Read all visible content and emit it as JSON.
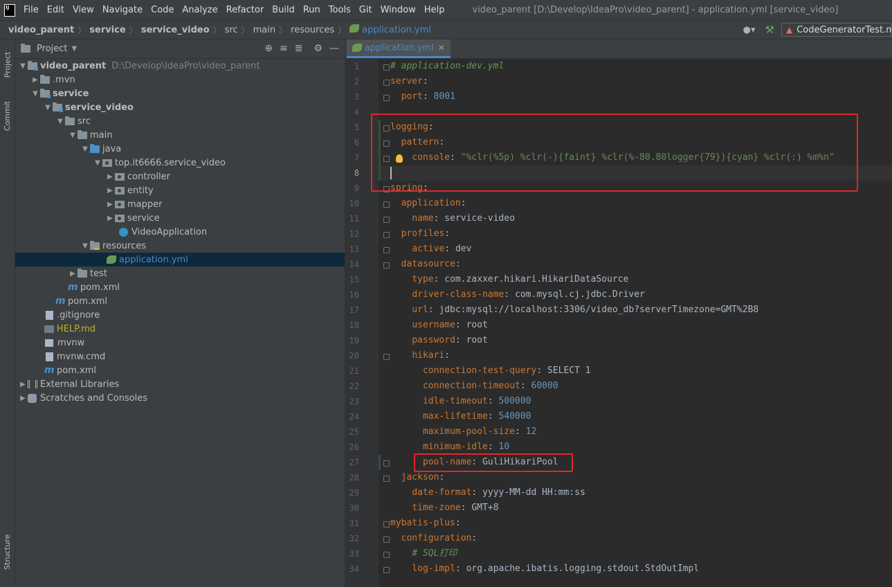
{
  "menubar": {
    "logo": "IJ",
    "items": [
      "File",
      "Edit",
      "View",
      "Navigate",
      "Code",
      "Analyze",
      "Refactor",
      "Build",
      "Run",
      "Tools",
      "Git",
      "Window",
      "Help"
    ],
    "window_title": "video_parent [D:\\Develop\\IdeaPro\\video_parent] - application.yml [service_video]"
  },
  "breadcrumbs": [
    "video_parent",
    "service",
    "service_video",
    "src",
    "main",
    "resources",
    "application.yml"
  ],
  "run_config": "CodeGeneratorTest.ma",
  "left_strip": {
    "project": "Project",
    "commit": "Commit",
    "structure": "Structure"
  },
  "project_panel": {
    "title": "Project",
    "root_name": "video_parent",
    "root_path": "D:\\Develop\\IdeaPro\\video_parent",
    "tree": [
      {
        "label": ".mvn"
      },
      {
        "label": "service"
      },
      {
        "label": "service_video"
      },
      {
        "label": "src"
      },
      {
        "label": "main"
      },
      {
        "label": "java"
      },
      {
        "label": "top.it6666.service_video"
      },
      {
        "label": "controller"
      },
      {
        "label": "entity"
      },
      {
        "label": "mapper"
      },
      {
        "label": "service"
      },
      {
        "label": "VideoApplication"
      },
      {
        "label": "resources"
      },
      {
        "label": "application.yml"
      },
      {
        "label": "test"
      },
      {
        "label": "pom.xml"
      },
      {
        "label": "pom.xml"
      },
      {
        "label": ".gitignore"
      },
      {
        "label": "HELP.md"
      },
      {
        "label": "mvnw"
      },
      {
        "label": "mvnw.cmd"
      },
      {
        "label": "pom.xml"
      },
      {
        "label": "External Libraries"
      },
      {
        "label": "Scratches and Consoles"
      }
    ]
  },
  "editor": {
    "tab_label": "application.yml",
    "line_numbers": [
      "1",
      "2",
      "3",
      "4",
      "5",
      "6",
      "7",
      "8",
      "9",
      "10",
      "11",
      "12",
      "13",
      "14",
      "15",
      "16",
      "17",
      "18",
      "19",
      "20",
      "21",
      "22",
      "23",
      "24",
      "25",
      "26",
      "27",
      "28",
      "29",
      "30",
      "31",
      "32",
      "33",
      "34"
    ],
    "lines": {
      "l1": "# application-dev.yml",
      "l2_key": "server",
      "l3_key": "port",
      "l3_val": "8001",
      "l5_key": "logging",
      "l6_key": "pattern",
      "l7_key": "console",
      "l7_val": "\"%clr(%5p) %clr(-){faint} %clr(%-80.80logger{79}){cyan} %clr(:) %m%n\"",
      "l9_key": "spring",
      "l10_key": "application",
      "l11_key": "name",
      "l11_val": "service-video",
      "l12_key": "profiles",
      "l13_key": "active",
      "l13_val": "dev",
      "l14_key": "datasource",
      "l15_key": "type",
      "l15_val": "com.zaxxer.hikari.HikariDataSource",
      "l16_key": "driver-class-name",
      "l16_val": "com.mysql.cj.jdbc.Driver",
      "l17_key": "url",
      "l17_val": "jdbc:mysql://localhost:3306/video_db?serverTimezone=GMT%2B8",
      "l18_key": "username",
      "l18_val": "root",
      "l19_key": "password",
      "l19_val": "root",
      "l20_key": "hikari",
      "l21_key": "connection-test-query",
      "l21_val": "SELECT 1",
      "l22_key": "connection-timeout",
      "l22_val": "60000",
      "l23_key": "idle-timeout",
      "l23_val": "500000",
      "l24_key": "max-lifetime",
      "l24_val": "540000",
      "l25_key": "maximum-pool-size",
      "l25_val": "12",
      "l26_key": "minimum-idle",
      "l26_val": "10",
      "l27_key": "pool-name",
      "l27_val": "GuliHikariPool",
      "l28_key": "jackson",
      "l29_key": "date-format",
      "l29_val": "yyyy-MM-dd HH:mm:ss",
      "l30_key": "time-zone",
      "l30_val": "GMT+8",
      "l31_key": "mybatis-plus",
      "l32_key": "configuration",
      "l33": "# SQL打印",
      "l34_key": "log-impl",
      "l34_val": "org.apache.ibatis.logging.stdout.StdOutImpl"
    }
  },
  "colors": {
    "highlight": "#e3262b",
    "accent": "#4a88c7"
  }
}
